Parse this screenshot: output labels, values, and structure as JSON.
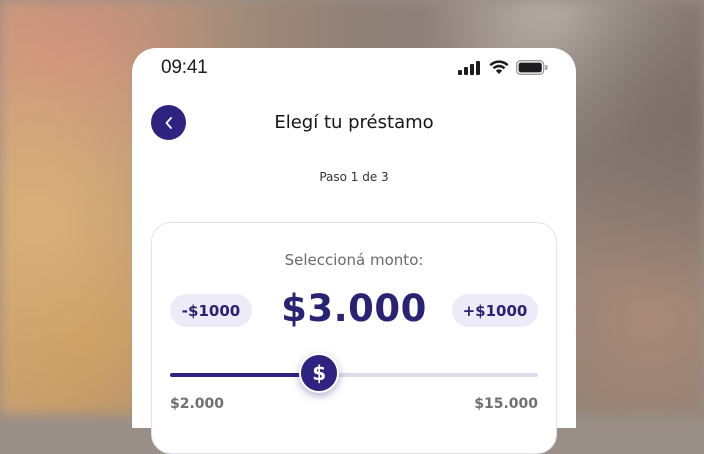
{
  "status_bar": {
    "time": "09:41",
    "icons": [
      "signal-icon",
      "wifi-icon",
      "battery-icon"
    ]
  },
  "header": {
    "back_icon": "chevron-left-icon",
    "title": "Elegí tu préstamo"
  },
  "step_text": "Paso 1 de 3",
  "amount_card": {
    "label": "Seleccioná monto:",
    "decrease_label": "-$1000",
    "increase_label": "+$1000",
    "amount": "$3.000",
    "slider": {
      "min_label": "$2.000",
      "max_label": "$15.000",
      "min": 2000,
      "max": 15000,
      "value": 3000,
      "thumb_symbol": "$"
    }
  },
  "colors": {
    "primary": "#2e2380",
    "pill_bg": "#ecebf7",
    "track": "#dcdbe8"
  }
}
